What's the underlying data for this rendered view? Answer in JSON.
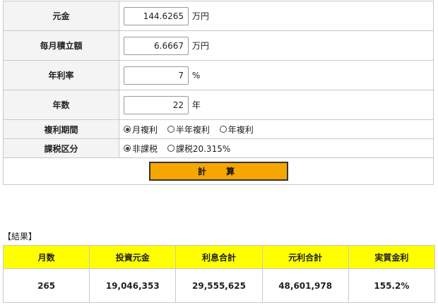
{
  "form": {
    "principal": {
      "label": "元金",
      "value": "144.6265",
      "unit": "万円"
    },
    "monthly": {
      "label": "毎月積立額",
      "value": "6.6667",
      "unit": "万円"
    },
    "rate": {
      "label": "年利率",
      "value": "7",
      "unit": "%"
    },
    "years": {
      "label": "年数",
      "value": "22",
      "unit": "年"
    },
    "compound": {
      "label": "複利期間",
      "options": [
        "月複利",
        "半年複利",
        "年複利"
      ],
      "selected": "月複利"
    },
    "tax": {
      "label": "課税区分",
      "options": [
        "非課税",
        "課税20.315%"
      ],
      "selected": "非課税"
    },
    "calc_button": "計 算"
  },
  "result": {
    "title": "【結果】",
    "headers": [
      "月数",
      "投資元金",
      "利息合計",
      "元利合計",
      "実質金利"
    ],
    "row": [
      "265",
      "19,046,353",
      "29,555,625",
      "48,601,978",
      "155.2%"
    ]
  },
  "colors": {
    "button": "#f5a600",
    "header_bg": "#ffff00",
    "label_bg": "#f4f4f4"
  }
}
